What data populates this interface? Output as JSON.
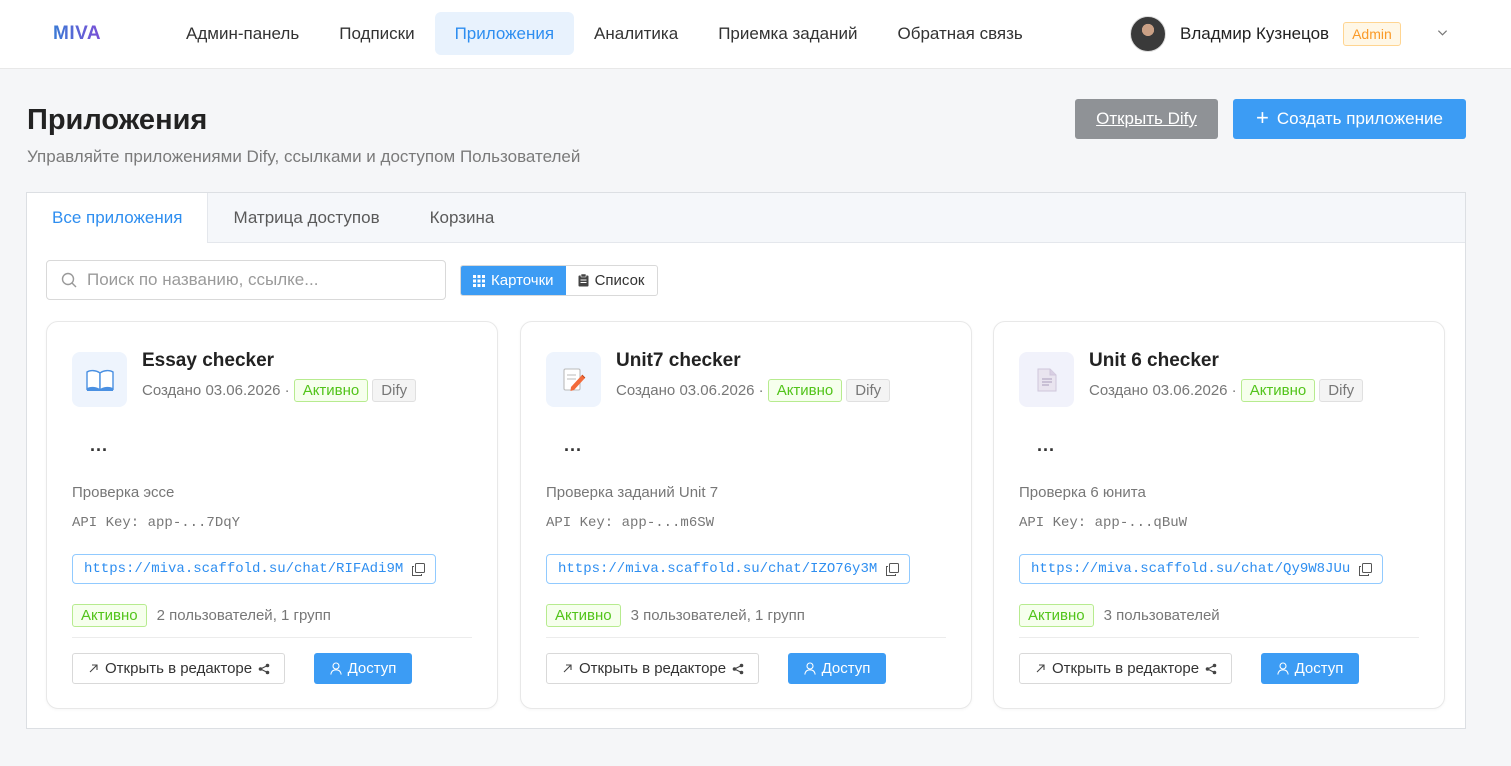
{
  "header": {
    "logo": "MIVA",
    "nav": [
      {
        "label": "Админ-панель"
      },
      {
        "label": "Подписки"
      },
      {
        "label": "Приложения"
      },
      {
        "label": "Аналитика"
      },
      {
        "label": "Приемка заданий"
      },
      {
        "label": "Обратная связь"
      }
    ],
    "active_nav": "Приложения",
    "user_name": "Владмир Кузнецов",
    "role_badge": "Admin"
  },
  "page": {
    "title": "Приложения",
    "subtitle": "Управляйте приложениями Dify, ссылками и доступом Пользователей",
    "open_dify_label": "Открыть Dify",
    "create_label": "Создать приложение"
  },
  "tabs": [
    {
      "label": "Все приложения"
    },
    {
      "label": "Матрица доступов"
    },
    {
      "label": "Корзина"
    }
  ],
  "active_tab": "Все приложения",
  "search": {
    "placeholder": "Поиск по названию, ссылке...",
    "value": ""
  },
  "view_toggle": {
    "cards": "Карточки",
    "list": "Список",
    "active": "Карточки"
  },
  "apps": [
    {
      "title": "Essay checker",
      "icon": "book-icon",
      "created": "Создано 03.06.2026 ·",
      "status": "Активно",
      "source": "Dify",
      "more": "...",
      "description": "Проверка эссе",
      "api_key": "API Key: app-...7DqY",
      "link": "https://miva.scaffold.su/chat/RIFAdi9M",
      "status_bottom": "Активно",
      "users": "2 пользователей, 1 групп",
      "edit_label": "Открыть в редакторе",
      "access_label": "Доступ"
    },
    {
      "title": "Unit7 checker",
      "icon": "pencil-note-icon",
      "created": "Создано 03.06.2026 ·",
      "status": "Активно",
      "source": "Dify",
      "more": "...",
      "description": "Проверка заданий Unit 7",
      "api_key": "API Key: app-...m6SW",
      "link": "https://miva.scaffold.su/chat/IZO76y3M",
      "status_bottom": "Активно",
      "users": "3 пользователей, 1 групп",
      "edit_label": "Открыть в редакторе",
      "access_label": "Доступ"
    },
    {
      "title": "Unit 6 checker",
      "icon": "document-icon",
      "created": "Создано 03.06.2026 ·",
      "status": "Активно",
      "source": "Dify",
      "more": "...",
      "description": "Проверка 6 юнита",
      "api_key": "API Key: app-...qBuW",
      "link": "https://miva.scaffold.su/chat/Qy9W8JUu",
      "status_bottom": "Активно",
      "users": "3 пользователей",
      "edit_label": "Открыть в редакторе",
      "access_label": "Доступ"
    }
  ],
  "colors": {
    "accent": "#3c9cf4",
    "active_nav_bg": "#e8f2fd",
    "status_green": "#52c41a",
    "admin_orange": "#fa9a28",
    "open_dify_gray": "#8f9296"
  }
}
